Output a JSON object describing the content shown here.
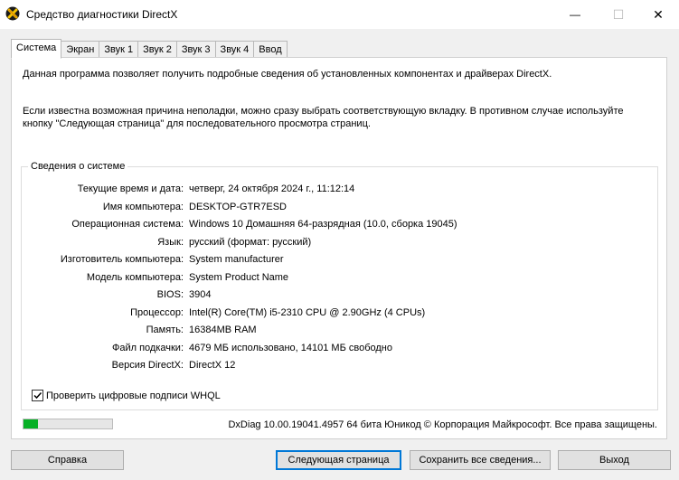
{
  "window": {
    "title": "Средство диагностики DirectX",
    "minimize_glyph": "—",
    "maximize_glyph": "☐",
    "close_glyph": "✕"
  },
  "tabs": [
    {
      "label": "Система",
      "active": true
    },
    {
      "label": "Экран"
    },
    {
      "label": "Звук 1"
    },
    {
      "label": "Звук 2"
    },
    {
      "label": "Звук 3"
    },
    {
      "label": "Звук 4"
    },
    {
      "label": "Ввод"
    }
  ],
  "intro": {
    "line1": "Данная программа позволяет получить подробные сведения об установленных компонентах и драйверах DirectX.",
    "line2": "Если известна возможная причина неполадки, можно сразу выбрать соответствующую вкладку. В противном случае используйте кнопку \"Следующая страница\" для последовательного просмотра страниц."
  },
  "system_info": {
    "group_title": "Сведения о системе",
    "rows": [
      {
        "label": "Текущие время и дата:",
        "value": "четверг, 24 октября 2024 г., 11:12:14"
      },
      {
        "label": "Имя компьютера:",
        "value": "DESKTOP-GTR7ESD"
      },
      {
        "label": "Операционная система:",
        "value": "Windows 10 Домашняя 64-разрядная (10.0, сборка 19045)"
      },
      {
        "label": "Язык:",
        "value": "русский (формат: русский)"
      },
      {
        "label": "Изготовитель компьютера:",
        "value": "System manufacturer"
      },
      {
        "label": "Модель компьютера:",
        "value": "System Product Name"
      },
      {
        "label": "BIOS:",
        "value": "3904"
      },
      {
        "label": "Процессор:",
        "value": "Intel(R) Core(TM) i5-2310 CPU @ 2.90GHz (4 CPUs)"
      },
      {
        "label": "Память:",
        "value": "16384MB RAM"
      },
      {
        "label": "Файл подкачки:",
        "value": "4679 МБ использовано, 14101 МБ свободно"
      },
      {
        "label": "Версия DirectX:",
        "value": "DirectX 12"
      }
    ]
  },
  "whql_checkbox": {
    "label": "Проверить цифровые подписи WHQL",
    "checked": true
  },
  "progress": {
    "fraction": 0.16,
    "color": "#06b025"
  },
  "footer": "DxDiag 10.00.19041.4957 64 бита Юникод © Корпорация Майкрософт. Все права защищены.",
  "buttons": {
    "help": "Справка",
    "next_page": "Следующая страница",
    "save_all": "Сохранить все сведения...",
    "exit": "Выход"
  },
  "colors": {
    "accent": "#0078d7",
    "window_bg": "#f0f0f0",
    "panel_bg": "#ffffff"
  },
  "icons": {
    "app": "directx-icon",
    "check": "checkmark-icon"
  }
}
